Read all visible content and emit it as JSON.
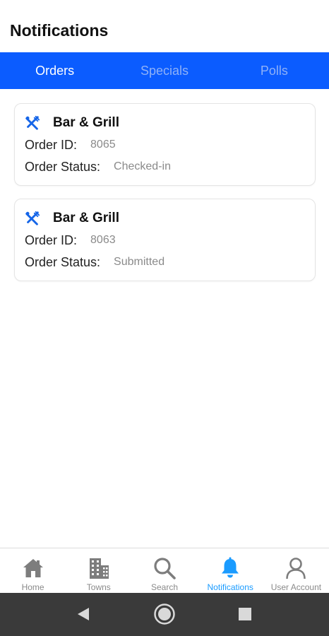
{
  "header": {
    "title": "Notifications"
  },
  "tabs": [
    {
      "label": "Orders",
      "active": true
    },
    {
      "label": "Specials",
      "active": false
    },
    {
      "label": "Polls",
      "active": false
    }
  ],
  "orders": [
    {
      "restaurant": "Bar & Grill",
      "order_id_label": "Order ID:",
      "order_id": "8065",
      "status_label": "Order Status:",
      "status": "Checked-in"
    },
    {
      "restaurant": "Bar & Grill",
      "order_id_label": "Order ID:",
      "order_id": "8063",
      "status_label": "Order Status:",
      "status": "Submitted"
    }
  ],
  "bottom_nav": [
    {
      "label": "Home",
      "icon": "home-icon",
      "active": false
    },
    {
      "label": "Towns",
      "icon": "buildings-icon",
      "active": false
    },
    {
      "label": "Search",
      "icon": "search-icon",
      "active": false
    },
    {
      "label": "Notifications",
      "icon": "bell-icon",
      "active": true
    },
    {
      "label": "User Account",
      "icon": "user-icon",
      "active": false
    }
  ],
  "system_bar": {
    "buttons": [
      "back-icon",
      "home-circle-icon",
      "recents-icon"
    ]
  },
  "colors": {
    "accent": "#0b5cff",
    "tab_inactive": "#8fb1f7",
    "nav_active": "#1a9bff",
    "nav_inactive": "#8a8a8a",
    "system_bar": "#3a3a3a"
  }
}
